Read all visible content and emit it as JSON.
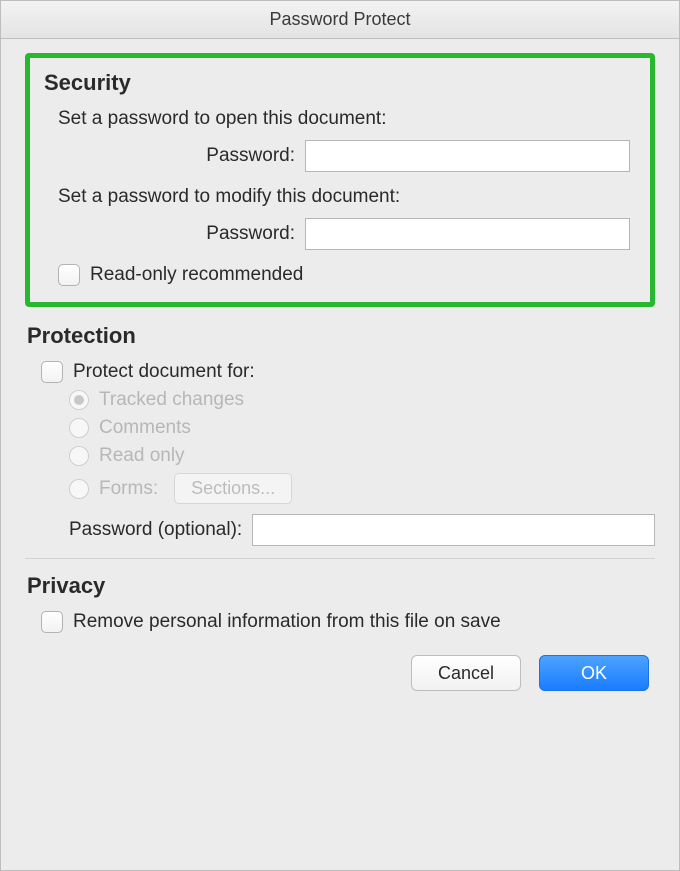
{
  "title": "Password Protect",
  "security": {
    "heading": "Security",
    "open_prompt": "Set a password to open this document:",
    "open_label": "Password:",
    "open_value": "",
    "modify_prompt": "Set a password to modify this document:",
    "modify_label": "Password:",
    "modify_value": "",
    "readonly_label": "Read-only recommended"
  },
  "protection": {
    "heading": "Protection",
    "protect_for_label": "Protect document for:",
    "options": {
      "tracked": "Tracked changes",
      "comments": "Comments",
      "readonly": "Read only",
      "forms": "Forms:"
    },
    "sections_button": "Sections...",
    "password_label": "Password (optional):",
    "password_value": ""
  },
  "privacy": {
    "heading": "Privacy",
    "remove_label": "Remove personal information from this file on save"
  },
  "footer": {
    "cancel": "Cancel",
    "ok": "OK"
  }
}
